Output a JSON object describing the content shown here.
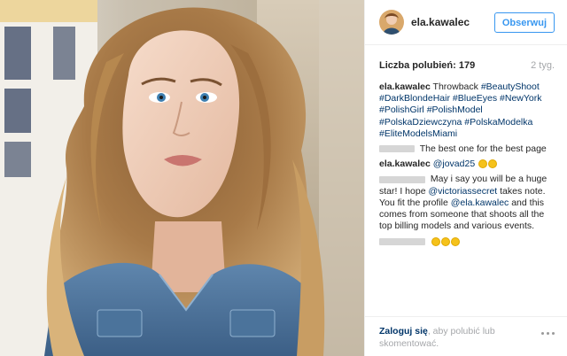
{
  "user": {
    "name": "ela.kawalec",
    "follow_label": "Obserwuj"
  },
  "stats": {
    "likes": "Liczba polubień: 179",
    "time": "2 tyg."
  },
  "caption": {
    "author": "ela.kawalec",
    "text": "Throwback",
    "hashtags": [
      "#BeautyShoot",
      "#DarkBlondeHair",
      "#BlueEyes",
      "#NewYork",
      "#PolishGirl",
      "#PolishModel",
      "#PolskaDziewczyna",
      "#PolskaModelka",
      "#EliteModelsMiami"
    ]
  },
  "comments": [
    {
      "text": "The best one for the best page"
    },
    {
      "author": "ela.kawalec",
      "mention": "@jovad25"
    },
    {
      "text_a": "May i say you will be a huge star! I hope",
      "mention_a": "@victoriassecret",
      "text_b": "takes note. You fit the profile",
      "mention_b": "@ela.kawalec",
      "text_c": "and this comes from someone that shoots all the top billing models and various events."
    }
  ],
  "footer": {
    "login_link": "Zaloguj się",
    "login_text": ", aby polubić lub skomentować."
  },
  "icons": {
    "more": "more-options-icon"
  }
}
